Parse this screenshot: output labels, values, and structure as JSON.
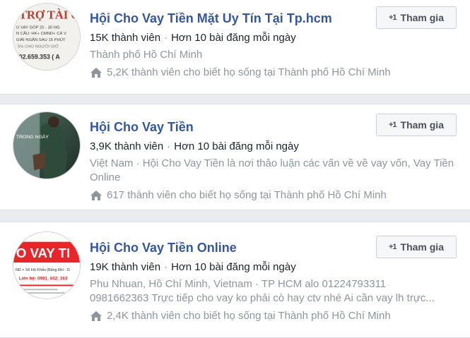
{
  "groups": [
    {
      "title": "Hội Cho Vay Tiền Mặt Uy Tín Tại Tp.hcm",
      "members": "15K thành viên",
      "activity": "Hơn 10 bài đăng mỗi ngày",
      "description": "Thành phố Hồ Chí Minh",
      "lived": "5,2K thành viên cho biết họ sống tại Thành phố Hồ Chí Minh",
      "join_label": "Tham gia",
      "avatar_icon": "group-avatar-poster-icon"
    },
    {
      "title": "Hội Cho Vay Tiền",
      "members": "3,9K thành viên",
      "activity": "Hơn 10 bài đăng mỗi ngày",
      "description": "Việt Nam · Hội Cho Vay Tiền là nơi thảo luận các vấn về về vay vốn, Vay Tiền Online",
      "lived": "617 thành viên cho biết họ sống tại Thành phố Hồ Chí Minh",
      "join_label": "Tham gia",
      "avatar_icon": "group-avatar-photo-icon"
    },
    {
      "title": "Hội Cho Vay Tiền Online",
      "members": "19K thành viên",
      "activity": "Hơn 10 bài đăng mỗi ngày",
      "description_line1": "Phu Nhuan, Hồ Chí Minh, Vietnam · TP HCM alo 01224793311",
      "description_line2": "0981662363 Trực tiếp cho vay ko phải cò hay ctv nhé Ai cần vay lh trực...",
      "lived": "2,4K thành viên cho biết họ sống tại Thành phố Hồ Chí Minh",
      "join_label": "Tham gia",
      "avatar_icon": "group-avatar-banner-icon"
    }
  ],
  "avatar_text": {
    "g0_heading": "TRỢ TÀI CH",
    "g0_line1": "O VAY GÓP 25 - 30 NG",
    "g0_line2": "N CẦU: HK+ CMND+ CÀ V",
    "g0_line3": "GIẢI NGÂN SAU 15 PHÚT",
    "g0_line4": "5% CHO NGƯỜI GIỚ",
    "g0_line5": "02.659.353 ( A",
    "g1_line1": "TRONG NGÀY",
    "g2_heading": "O VAY TI",
    "g2_line1": "ND + Sổ Hộ Khẩu (Bảng ĐH - G",
    "g2_line2": "Liên hệ: 0981. 662. 363"
  },
  "icons": {
    "join": "+1",
    "home": "home-icon"
  },
  "colors": {
    "title": "#365899",
    "muted": "#90949c",
    "text": "#1d2129",
    "brand_red": "#e8262a",
    "accent_bar": "#4267b2"
  }
}
